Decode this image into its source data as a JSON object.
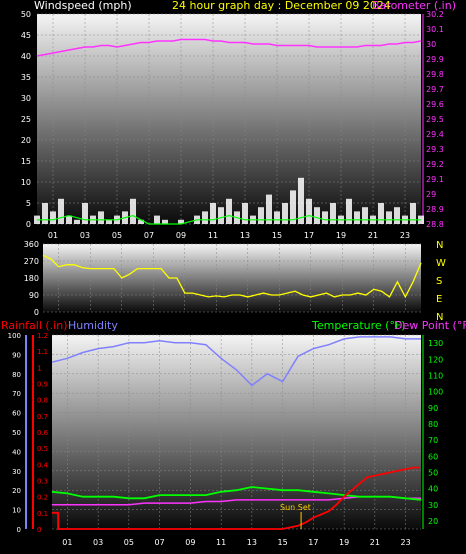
{
  "page": {
    "title": "24 hour graph day : December 09 2024",
    "background": "#000000"
  },
  "colors": {
    "wind": "#ffffff",
    "wind_gust": "#00ff00",
    "barometer": "#ff33ff",
    "direction": "#ffff00",
    "rainfall": "#ff0000",
    "humidity": "#8080ff",
    "temperature": "#00ff00",
    "dew_point": "#ff33ff",
    "sunset": "#ffcc00",
    "white_axis": "#ffffff",
    "green_axis": "#00ff00"
  },
  "x_tick_labels": [
    "01",
    "03",
    "05",
    "07",
    "09",
    "11",
    "13",
    "15",
    "17",
    "19",
    "21",
    "23"
  ],
  "x_tick_hours": [
    1,
    3,
    5,
    7,
    9,
    11,
    13,
    15,
    17,
    19,
    21,
    23
  ],
  "chart_data": [
    {
      "type": "line",
      "panel": "wind-barometer",
      "title": "24 hour graph day : December 09 2024",
      "left_axis_label": "Windspeed (mph)",
      "right_axis_label": "Barometer (.in)",
      "left_ticks": [
        "0",
        "5",
        "10",
        "15",
        "20",
        "25",
        "30",
        "35",
        "40",
        "45",
        "50"
      ],
      "right_ticks": [
        "28.8",
        "28.9",
        "29",
        "29.1",
        "29.2",
        "29.3",
        "29.4",
        "29.5",
        "29.6",
        "29.7",
        "29.8",
        "29.9",
        "30",
        "30.1",
        "30.2"
      ],
      "left_range": [
        0,
        50
      ],
      "right_range": [
        28.8,
        30.2
      ],
      "x_range": [
        0,
        24
      ],
      "series": [
        {
          "name": "Barometer",
          "x": [
            0,
            0.5,
            1,
            1.5,
            2,
            2.5,
            3,
            3.5,
            4,
            4.5,
            5,
            5.5,
            6,
            6.5,
            7,
            7.5,
            8,
            8.5,
            9,
            9.5,
            10,
            10.5,
            11,
            11.5,
            12,
            12.5,
            13,
            13.5,
            14,
            14.5,
            15,
            15.5,
            16,
            16.5,
            17,
            17.5,
            18,
            18.5,
            19,
            19.5,
            20,
            20.5,
            21,
            21.5,
            22,
            22.5,
            23,
            23.5,
            24
          ],
          "values": [
            29.92,
            29.93,
            29.94,
            29.95,
            29.96,
            29.97,
            29.98,
            29.98,
            29.99,
            29.99,
            29.98,
            29.99,
            30.0,
            30.01,
            30.01,
            30.02,
            30.02,
            30.02,
            30.03,
            30.03,
            30.03,
            30.03,
            30.02,
            30.02,
            30.01,
            30.01,
            30.01,
            30.0,
            30.0,
            30.0,
            29.99,
            29.99,
            29.99,
            29.99,
            29.99,
            29.98,
            29.98,
            29.98,
            29.98,
            29.98,
            29.98,
            29.99,
            29.99,
            29.99,
            30.0,
            30.0,
            30.01,
            30.01,
            30.02
          ]
        },
        {
          "name": "Windspeed",
          "x": [
            0,
            0.5,
            1,
            1.5,
            2,
            2.5,
            3,
            3.5,
            4,
            4.5,
            5,
            5.5,
            6,
            6.5,
            7,
            7.5,
            8,
            8.5,
            9,
            9.5,
            10,
            10.5,
            11,
            11.5,
            12,
            12.5,
            13,
            13.5,
            14,
            14.5,
            15,
            15.5,
            16,
            16.5,
            17,
            17.5,
            18,
            18.5,
            19,
            19.5,
            20,
            20.5,
            21,
            21.5,
            22,
            22.5,
            23,
            23.5,
            24
          ],
          "values": [
            2,
            5,
            3,
            6,
            2,
            1,
            5,
            2,
            3,
            1,
            2,
            3,
            6,
            1,
            0,
            2,
            1,
            0,
            1,
            0,
            2,
            3,
            5,
            4,
            6,
            3,
            5,
            2,
            4,
            7,
            3,
            5,
            8,
            11,
            6,
            4,
            3,
            5,
            2,
            6,
            3,
            4,
            2,
            5,
            3,
            4,
            2,
            5,
            2
          ]
        },
        {
          "name": "Wind Gust",
          "x": [
            0,
            1,
            2,
            3,
            4,
            5,
            6,
            7,
            8,
            9,
            10,
            11,
            12,
            13,
            14,
            15,
            16,
            17,
            18,
            19,
            20,
            21,
            22,
            23,
            24
          ],
          "values": [
            1,
            1,
            2,
            1,
            1,
            1,
            2,
            0,
            0,
            0,
            1,
            1,
            2,
            1,
            1,
            1,
            1,
            2,
            1,
            1,
            1,
            1,
            1,
            1,
            1
          ]
        }
      ]
    },
    {
      "type": "line",
      "panel": "wind-direction",
      "left_ticks": [
        "0",
        "90",
        "180",
        "270",
        "360"
      ],
      "right_ticks": [
        "N",
        "W",
        "S",
        "E",
        "N"
      ],
      "left_range": [
        0,
        360
      ],
      "x_range": [
        0,
        24
      ],
      "series": [
        {
          "name": "Wind Direction",
          "x": [
            0,
            0.5,
            1,
            1.5,
            2,
            2.5,
            3,
            3.5,
            4,
            4.5,
            5,
            5.5,
            6,
            6.5,
            7,
            7.5,
            8,
            8.5,
            9,
            9.5,
            10,
            10.5,
            11,
            11.5,
            12,
            12.5,
            13,
            13.5,
            14,
            14.5,
            15,
            15.5,
            16,
            16.5,
            17,
            17.5,
            18,
            18.5,
            19,
            19.5,
            20,
            20.5,
            21,
            21.5,
            22,
            22.5,
            23,
            23.5,
            24
          ],
          "values": [
            300,
            280,
            240,
            250,
            250,
            235,
            230,
            230,
            230,
            230,
            180,
            200,
            230,
            230,
            230,
            230,
            180,
            180,
            100,
            100,
            90,
            80,
            85,
            80,
            90,
            90,
            80,
            90,
            100,
            90,
            90,
            100,
            110,
            90,
            80,
            90,
            100,
            80,
            90,
            90,
            100,
            90,
            120,
            110,
            80,
            160,
            80,
            160,
            260
          ]
        }
      ]
    },
    {
      "type": "line",
      "panel": "rain-humidity-temperature",
      "left_axis_label": "Rainfall (.in)",
      "left_axis2_label": "Humidity",
      "right_axis_label": "Temperature (°F)",
      "right_axis2_label": "Dew Point (°F)",
      "rain_ticks": [
        "0",
        "0.1",
        "0.2",
        "0.3",
        "0.4",
        "0.5",
        "0.6",
        "0.7",
        "0.8",
        "0.9",
        "1",
        "1.1",
        "1.2"
      ],
      "humidity_ticks": [
        "0",
        "10",
        "20",
        "30",
        "40",
        "50",
        "60",
        "70",
        "80",
        "90",
        "100"
      ],
      "temperature_ticks": [
        "20",
        "30",
        "40",
        "50",
        "60",
        "70",
        "80",
        "90",
        "100",
        "110",
        "120",
        "130"
      ],
      "rain_range": [
        0,
        1.2
      ],
      "humidity_range": [
        0,
        100
      ],
      "temperature_range": [
        15,
        135
      ],
      "x_range": [
        0,
        24
      ],
      "annotations": [
        "Sun Set"
      ],
      "series": [
        {
          "name": "Humidity",
          "x": [
            0,
            1,
            2,
            3,
            4,
            5,
            6,
            7,
            8,
            9,
            10,
            11,
            12,
            13,
            14,
            15,
            16,
            17,
            18,
            19,
            20,
            21,
            22,
            23,
            24
          ],
          "values": [
            86,
            88,
            91,
            93,
            94,
            96,
            96,
            97,
            96,
            96,
            95,
            88,
            82,
            74,
            80,
            76,
            89,
            93,
            95,
            98,
            99,
            99,
            99,
            98,
            98
          ]
        },
        {
          "name": "Temperature",
          "x": [
            0,
            1,
            2,
            3,
            4,
            5,
            6,
            7,
            8,
            9,
            10,
            11,
            12,
            13,
            14,
            15,
            16,
            17,
            18,
            19,
            20,
            21,
            22,
            23,
            24
          ],
          "values": [
            38,
            37,
            35,
            35,
            35,
            34,
            34,
            36,
            36,
            36,
            36,
            38,
            39,
            41,
            40,
            39,
            39,
            38,
            37,
            36,
            35,
            35,
            35,
            34,
            33
          ]
        },
        {
          "name": "Dew Point",
          "x": [
            0,
            1,
            2,
            3,
            4,
            5,
            6,
            7,
            8,
            9,
            10,
            11,
            12,
            13,
            14,
            15,
            16,
            17,
            18,
            19,
            20,
            21,
            22,
            23,
            24
          ],
          "values": [
            30,
            30,
            30,
            30,
            30,
            30,
            31,
            31,
            31,
            31,
            32,
            32,
            33,
            33,
            33,
            33,
            33,
            33,
            33,
            34,
            35,
            35,
            35,
            34,
            34
          ]
        },
        {
          "name": "Rainfall",
          "x": [
            0,
            0.4,
            0.4,
            9,
            15,
            15.5,
            16,
            16.5,
            17,
            17.5,
            18,
            18.5,
            19,
            19.5,
            20,
            20.5,
            21,
            21.5,
            22,
            22.5,
            23,
            23.5,
            23.9
          ],
          "values": [
            0.1,
            0.1,
            0,
            0,
            0,
            0.01,
            0.02,
            0.04,
            0.07,
            0.09,
            0.11,
            0.15,
            0.2,
            0.24,
            0.28,
            0.32,
            0.33,
            0.34,
            0.35,
            0.36,
            0.37,
            0.38,
            0.38
          ]
        }
      ]
    }
  ]
}
